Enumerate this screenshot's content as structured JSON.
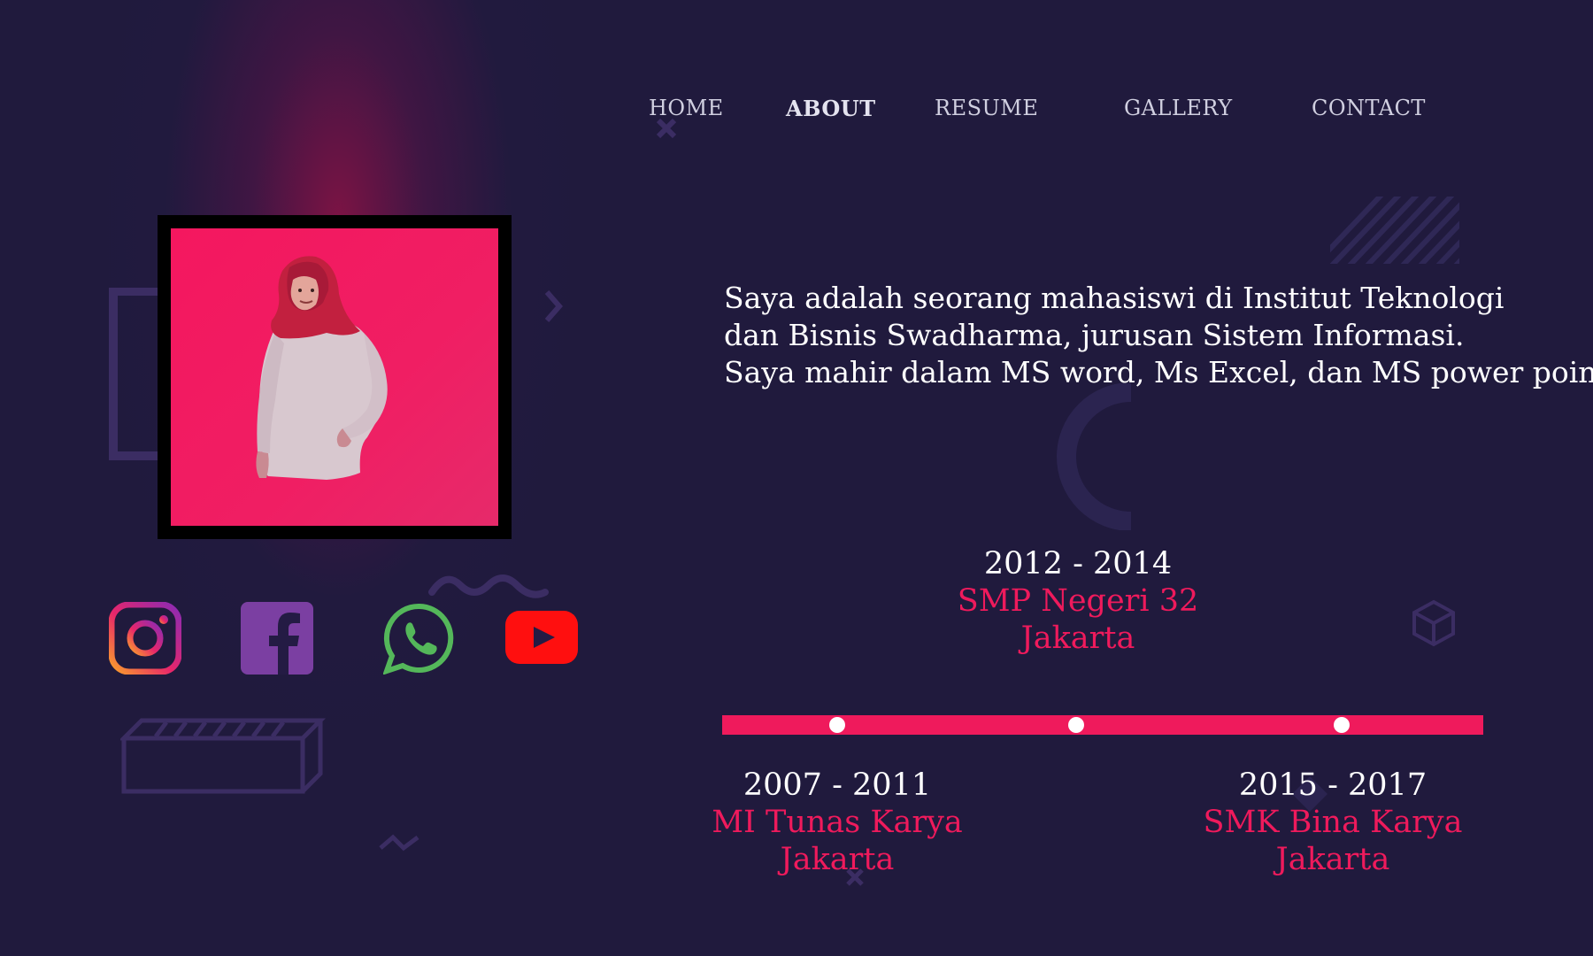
{
  "nav": {
    "items": [
      {
        "label": "HOME"
      },
      {
        "label": "ABOUT"
      },
      {
        "label": "RESUME"
      },
      {
        "label": "GALLERY"
      },
      {
        "label": "CONTACT"
      }
    ],
    "active": "ABOUT"
  },
  "about": {
    "lines": [
      "Saya adalah seorang mahasiswi di Institut Teknologi",
      "dan Bisnis Swadharma, jurusan Sistem Informasi.",
      "Saya mahir dalam MS word, Ms Excel, dan MS power point."
    ]
  },
  "social": [
    {
      "icon": "instagram-icon"
    },
    {
      "icon": "facebook-icon"
    },
    {
      "icon": "whatsapp-icon"
    },
    {
      "icon": "youtube-icon"
    }
  ],
  "education": [
    {
      "years": "2007 - 2011",
      "school": "MI Tunas Karya",
      "city": "Jakarta"
    },
    {
      "years": "2012 - 2014",
      "school": "SMP Negeri 32",
      "city": "Jakarta"
    },
    {
      "years": "2015 - 2017",
      "school": "SMK Bina Karya",
      "city": "Jakarta"
    }
  ],
  "colors": {
    "background": "#201a3d",
    "accent": "#ef1a5c",
    "text": "#ffffff"
  }
}
